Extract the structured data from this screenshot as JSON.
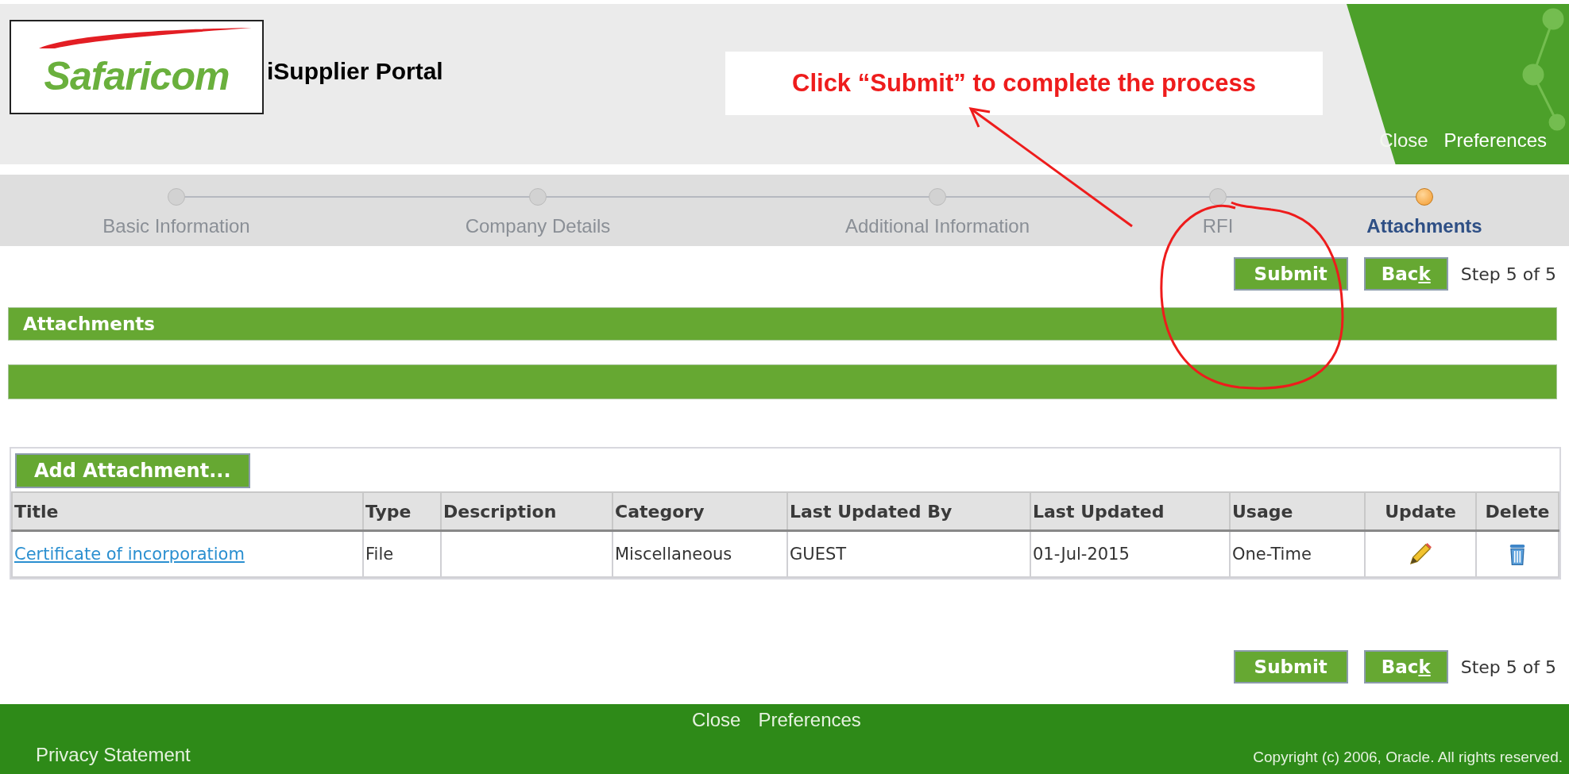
{
  "header": {
    "logo": "Safaricom",
    "portal_title": "iSupplier Portal",
    "links": [
      "Close",
      "Preferences"
    ]
  },
  "callout": {
    "text": "Click “Submit” to complete the process"
  },
  "steps": [
    {
      "label": "Basic Information",
      "selected": false
    },
    {
      "label": "Company Details",
      "selected": false
    },
    {
      "label": "Additional Information",
      "selected": false
    },
    {
      "label": "RFI",
      "selected": false
    },
    {
      "label": "Attachments",
      "selected": true
    }
  ],
  "top_actions": {
    "submit": "Submit",
    "back_before": "Bac",
    "back_key": "k",
    "step": "Step 5 of 5"
  },
  "section_title": "Attachments",
  "add_button": "Add Attachment...",
  "table": {
    "columns": [
      "Title",
      "Type",
      "Description",
      "Category",
      "Last Updated By",
      "Last Updated",
      "Usage",
      "Update",
      "Delete"
    ],
    "rows": [
      {
        "title": "Certificate of incorporatiom",
        "type": "File",
        "description": "",
        "category": "Miscellaneous",
        "last_updated_by": "GUEST",
        "last_updated": "01-Jul-2015",
        "usage": "One-Time"
      }
    ]
  },
  "bottom_actions": {
    "submit": "Submit",
    "back_before": "Bac",
    "back_key": "k",
    "step": "Step 5 of 5"
  },
  "footer": {
    "links": [
      "Close",
      "Preferences"
    ],
    "privacy": "Privacy Statement",
    "copyright": "Copyright (c) 2006, Oracle. All rights reserved."
  }
}
